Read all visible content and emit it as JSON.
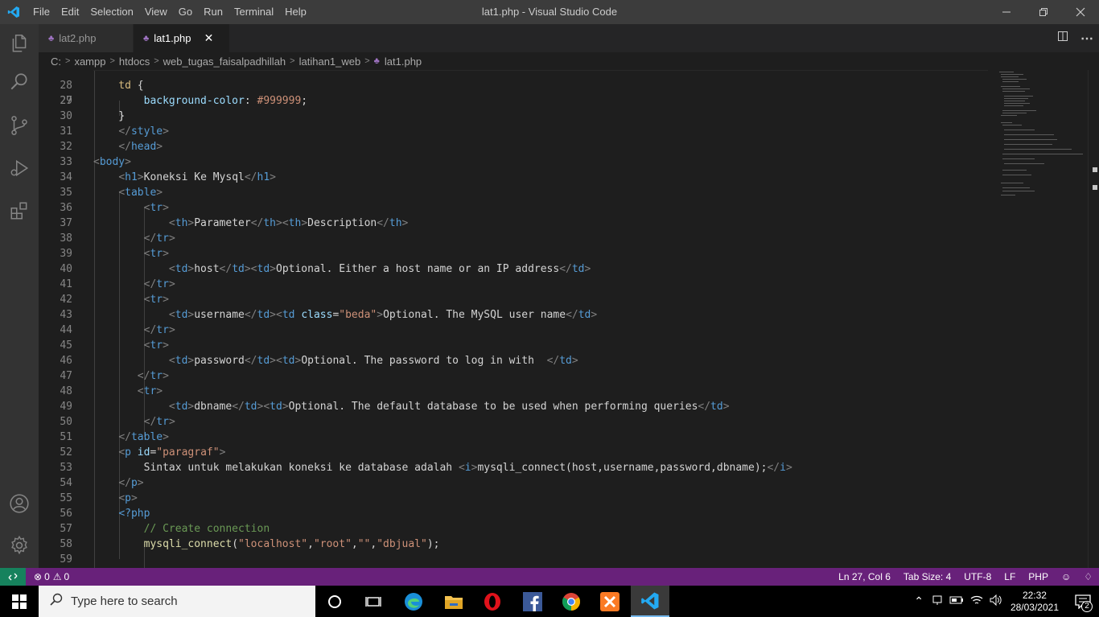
{
  "titlebar": {
    "menu": [
      "File",
      "Edit",
      "Selection",
      "View",
      "Go",
      "Run",
      "Terminal",
      "Help"
    ],
    "title": "lat1.php - Visual Studio Code"
  },
  "tabs": [
    {
      "label": "lat2.php",
      "active": false
    },
    {
      "label": "lat1.php",
      "active": true
    }
  ],
  "breadcrumbs": [
    "C:",
    "xampp",
    "htdocs",
    "web_tugas_faisalpadhillah",
    "latihan1_web",
    "lat1.php"
  ],
  "editor": {
    "first_partial_line": "27",
    "line_numbers": [
      "28",
      "29",
      "30",
      "31",
      "32",
      "33",
      "34",
      "35",
      "36",
      "37",
      "38",
      "39",
      "40",
      "41",
      "42",
      "43",
      "44",
      "45",
      "46",
      "47",
      "48",
      "49",
      "50",
      "51",
      "52",
      "53",
      "54",
      "55",
      "56",
      "57",
      "58",
      "59"
    ]
  },
  "statusbar": {
    "problems": "0",
    "warnings": "0",
    "position": "Ln 27, Col 6",
    "tab_size": "Tab Size: 4",
    "encoding": "UTF-8",
    "eol": "LF",
    "language": "PHP"
  },
  "taskbar": {
    "search_placeholder": "Type here to search",
    "time": "22:32",
    "date": "28/03/2021",
    "notifications": "2"
  },
  "colors": {
    "statusbar": "#68217a",
    "remote": "#16825d",
    "activitybar": "#333333",
    "editor_bg": "#1e1e1e"
  }
}
